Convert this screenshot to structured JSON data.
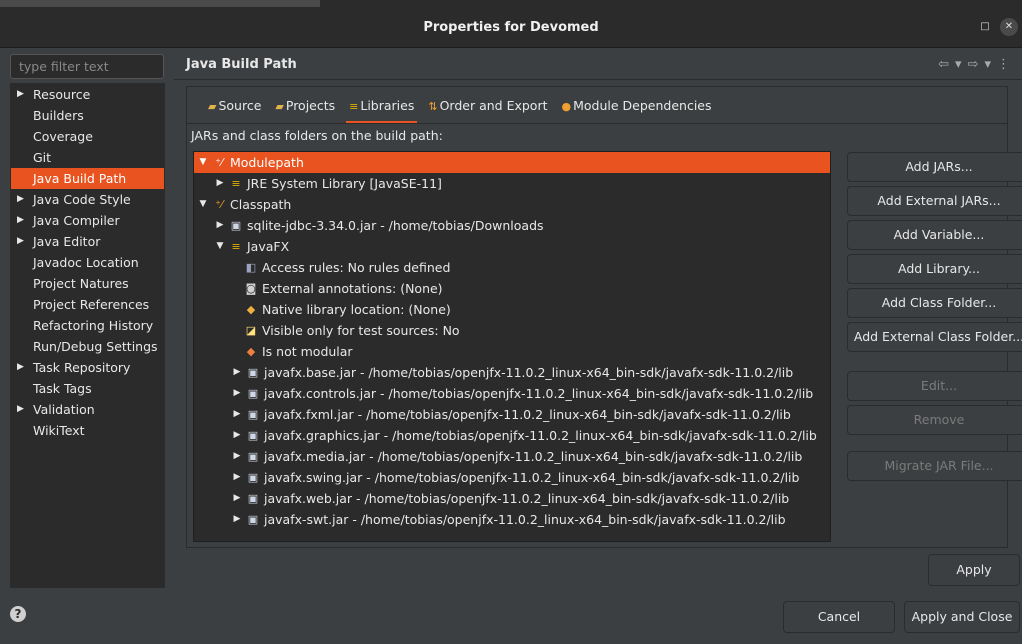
{
  "window": {
    "title": "Properties for Devomed"
  },
  "filter": {
    "placeholder": "type filter text"
  },
  "sidebar": {
    "items": [
      {
        "label": "Resource",
        "expandable": true,
        "selected": false
      },
      {
        "label": "Builders",
        "expandable": false,
        "selected": false
      },
      {
        "label": "Coverage",
        "expandable": false,
        "selected": false
      },
      {
        "label": "Git",
        "expandable": false,
        "selected": false
      },
      {
        "label": "Java Build Path",
        "expandable": false,
        "selected": true
      },
      {
        "label": "Java Code Style",
        "expandable": true,
        "selected": false
      },
      {
        "label": "Java Compiler",
        "expandable": true,
        "selected": false
      },
      {
        "label": "Java Editor",
        "expandable": true,
        "selected": false
      },
      {
        "label": "Javadoc Location",
        "expandable": false,
        "selected": false
      },
      {
        "label": "Project Natures",
        "expandable": false,
        "selected": false
      },
      {
        "label": "Project References",
        "expandable": false,
        "selected": false
      },
      {
        "label": "Refactoring History",
        "expandable": false,
        "selected": false
      },
      {
        "label": "Run/Debug Settings",
        "expandable": false,
        "selected": false
      },
      {
        "label": "Task Repository",
        "expandable": true,
        "selected": false
      },
      {
        "label": "Task Tags",
        "expandable": false,
        "selected": false
      },
      {
        "label": "Validation",
        "expandable": true,
        "selected": false
      },
      {
        "label": "WikiText",
        "expandable": false,
        "selected": false
      }
    ]
  },
  "page": {
    "header": "Java Build Path",
    "tabs": [
      {
        "label": "Source",
        "icon": "source-folder-icon",
        "active": false
      },
      {
        "label": "Projects",
        "icon": "projects-icon",
        "active": false
      },
      {
        "label": "Libraries",
        "icon": "libraries-icon",
        "active": true
      },
      {
        "label": "Order and Export",
        "icon": "order-export-icon",
        "active": false
      },
      {
        "label": "Module Dependencies",
        "icon": "module-dependencies-icon",
        "active": false
      }
    ],
    "jars_label": "JARs and class folders on the build path:"
  },
  "tree": {
    "rows": [
      {
        "depth": 0,
        "twisty": "open",
        "icon": "path-icon",
        "text": "Modulepath",
        "selected": true
      },
      {
        "depth": 1,
        "twisty": "closed",
        "icon": "library-icon",
        "text": "JRE System Library [JavaSE-11]",
        "selected": false
      },
      {
        "depth": 0,
        "twisty": "open",
        "icon": "path-icon",
        "text": "Classpath",
        "selected": false
      },
      {
        "depth": 1,
        "twisty": "closed",
        "icon": "jar-icon",
        "text": "sqlite-jdbc-3.34.0.jar - /home/tobias/Downloads",
        "selected": false
      },
      {
        "depth": 1,
        "twisty": "open",
        "icon": "library-icon",
        "text": "JavaFX",
        "selected": false
      },
      {
        "depth": 2,
        "twisty": "none",
        "icon": "access-rules-icon",
        "text": "Access rules: No rules defined",
        "selected": false
      },
      {
        "depth": 2,
        "twisty": "none",
        "icon": "annotations-icon",
        "text": "External annotations: (None)",
        "selected": false
      },
      {
        "depth": 2,
        "twisty": "none",
        "icon": "native-library-icon",
        "text": "Native library location: (None)",
        "selected": false
      },
      {
        "depth": 2,
        "twisty": "none",
        "icon": "visible-test-icon",
        "text": "Visible only for test sources: No",
        "selected": false
      },
      {
        "depth": 2,
        "twisty": "none",
        "icon": "modular-icon",
        "text": "Is not modular",
        "selected": false
      },
      {
        "depth": 2,
        "twisty": "closed",
        "icon": "jar-icon",
        "text": "javafx.base.jar - /home/tobias/openjfx-11.0.2_linux-x64_bin-sdk/javafx-sdk-11.0.2/lib",
        "selected": false
      },
      {
        "depth": 2,
        "twisty": "closed",
        "icon": "jar-icon",
        "text": "javafx.controls.jar - /home/tobias/openjfx-11.0.2_linux-x64_bin-sdk/javafx-sdk-11.0.2/lib",
        "selected": false
      },
      {
        "depth": 2,
        "twisty": "closed",
        "icon": "jar-icon",
        "text": "javafx.fxml.jar - /home/tobias/openjfx-11.0.2_linux-x64_bin-sdk/javafx-sdk-11.0.2/lib",
        "selected": false
      },
      {
        "depth": 2,
        "twisty": "closed",
        "icon": "jar-icon",
        "text": "javafx.graphics.jar - /home/tobias/openjfx-11.0.2_linux-x64_bin-sdk/javafx-sdk-11.0.2/lib",
        "selected": false
      },
      {
        "depth": 2,
        "twisty": "closed",
        "icon": "jar-icon",
        "text": "javafx.media.jar - /home/tobias/openjfx-11.0.2_linux-x64_bin-sdk/javafx-sdk-11.0.2/lib",
        "selected": false
      },
      {
        "depth": 2,
        "twisty": "closed",
        "icon": "jar-icon",
        "text": "javafx.swing.jar - /home/tobias/openjfx-11.0.2_linux-x64_bin-sdk/javafx-sdk-11.0.2/lib",
        "selected": false
      },
      {
        "depth": 2,
        "twisty": "closed",
        "icon": "jar-icon",
        "text": "javafx.web.jar - /home/tobias/openjfx-11.0.2_linux-x64_bin-sdk/javafx-sdk-11.0.2/lib",
        "selected": false
      },
      {
        "depth": 2,
        "twisty": "closed",
        "icon": "jar-icon",
        "text": "javafx-swt.jar - /home/tobias/openjfx-11.0.2_linux-x64_bin-sdk/javafx-sdk-11.0.2/lib",
        "selected": false
      }
    ]
  },
  "buttons": {
    "add_jars": "Add JARs...",
    "add_external_jars": "Add External JARs...",
    "add_variable": "Add Variable...",
    "add_library": "Add Library...",
    "add_class_folder": "Add Class Folder...",
    "add_external_class_folder": "Add External Class Folder...",
    "edit": "Edit...",
    "remove": "Remove",
    "migrate_jar": "Migrate JAR File...",
    "apply": "Apply",
    "cancel": "Cancel",
    "apply_and_close": "Apply and Close"
  },
  "colors": {
    "accent": "#e8531f",
    "background": "#3c3f41",
    "panel": "#2b2b2b"
  }
}
